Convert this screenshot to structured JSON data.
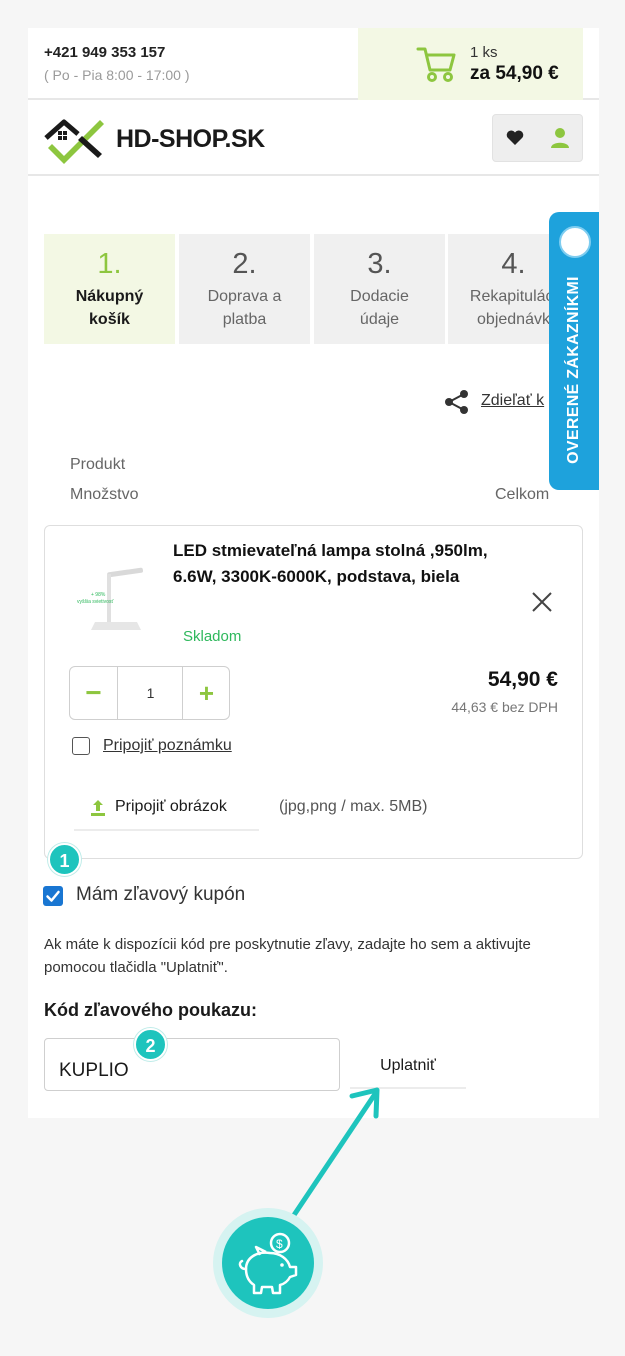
{
  "topbar": {
    "phone": "+421 949 353 157",
    "hours": "( Po - Pia 8:00 - 17:00 )",
    "cart_count": "1 ks",
    "cart_total": "za 54,90 €",
    "cart_icon": "cart-icon"
  },
  "header": {
    "logo_text": "HD-SHOP.SK",
    "icons": [
      "heart-icon",
      "user-icon"
    ]
  },
  "steps": [
    {
      "num": "1.",
      "label": "Nákupný košík",
      "active": true
    },
    {
      "num": "2.",
      "label": "Doprava a platba",
      "active": false
    },
    {
      "num": "3.",
      "label": "Dodacie údaje",
      "active": false
    },
    {
      "num": "4.",
      "label": "Rekapituláci objednávk",
      "active": false
    }
  ],
  "share": {
    "label": "Zdieľať k",
    "icon": "share-icon"
  },
  "columns": {
    "product": "Produkt",
    "quantity": "Množstvo",
    "total": "Celkom"
  },
  "product": {
    "name": "LED stmievateľná lampa stolná ,950lm, 6.6W, 3300K-6000K, podstava, biela",
    "stock": "Skladom",
    "quantity": "1",
    "price": "54,90 €",
    "price_net": "44,63 € bez DPH",
    "note_label": "Pripojiť poznámku",
    "image_button": "Pripojiť obrázok",
    "image_hint": "(jpg,png / max. 5MB)",
    "thumb_text": "+ 98% vyššia svietivosť"
  },
  "coupon": {
    "checkbox_label": "Mám zľavový kupón",
    "checked": true,
    "help": "Ak máte k dispozícii kód pre poskytnutie zľavy, zadajte ho sem a aktivujte pomocou tlačidla \"Uplatniť\".",
    "field_label": "Kód zľavového poukazu:",
    "value": "KUPLIO",
    "apply_label": "Uplatniť"
  },
  "annotations": {
    "badge_1": "1",
    "badge_2": "2",
    "accent": "#1ec4bd"
  },
  "side_badge": {
    "text": "OVERENÉ ZÁKAZNÍKMI",
    "color": "#1ea2dc"
  },
  "colors": {
    "brand_green": "#8dc63f",
    "stock_green": "#2eb85c",
    "cart_bg": "#f3f8e4"
  }
}
